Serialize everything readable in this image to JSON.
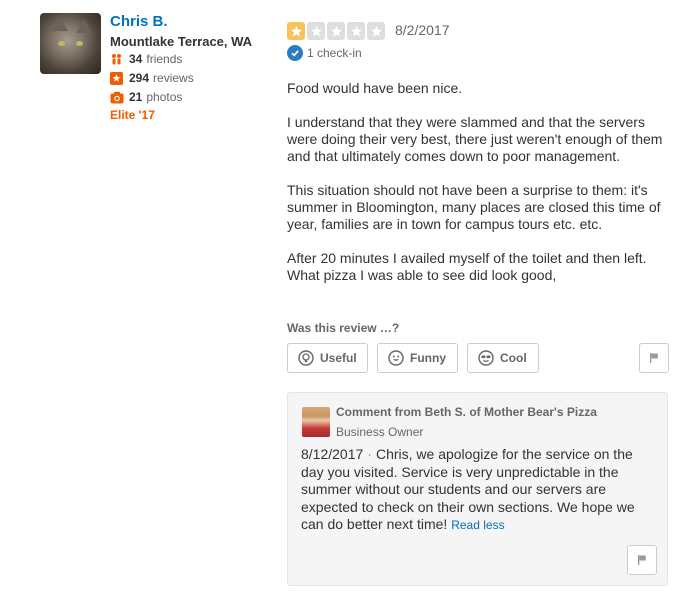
{
  "user": {
    "name": "Chris B.",
    "location": "Mountlake Terrace, WA",
    "friends_count": "34",
    "friends_label": "friends",
    "reviews_count": "294",
    "reviews_label": "reviews",
    "photos_count": "21",
    "photos_label": "photos",
    "elite": "Elite '17"
  },
  "review": {
    "rating": 1,
    "max_rating": 5,
    "date": "8/2/2017",
    "checkin": "1 check-in",
    "paragraphs": [
      "Food would have been nice.",
      "I understand that they were slammed and that the servers were doing their very best, there just weren't enough of them and that ultimately comes down to poor management.",
      "This situation should not have been a surprise to them: it's summer in Bloomington, many places are closed this time of year, families are in town for campus tours etc. etc.",
      "After 20 minutes I availed myself of the toilet and then left. What pizza I was able to see did look good,"
    ]
  },
  "votes": {
    "question": "Was this review …?",
    "useful": "Useful",
    "funny": "Funny",
    "cool": "Cool"
  },
  "comment": {
    "title": "Comment from Beth S. of Mother Bear's Pizza",
    "role": "Business Owner",
    "date": "8/12/2017",
    "separator": "·",
    "text": "Chris, we apologize for the service on the day you visited. Service is very unpredictable in the summer without our students and our servers are expected to check on their own sections. We hope we can do better next time!",
    "read_less": "Read less"
  },
  "colors": {
    "link_blue": "#0073bb",
    "elite_orange": "#f15c00",
    "star_on": "#f7c35b",
    "star_off": "#dedede"
  }
}
